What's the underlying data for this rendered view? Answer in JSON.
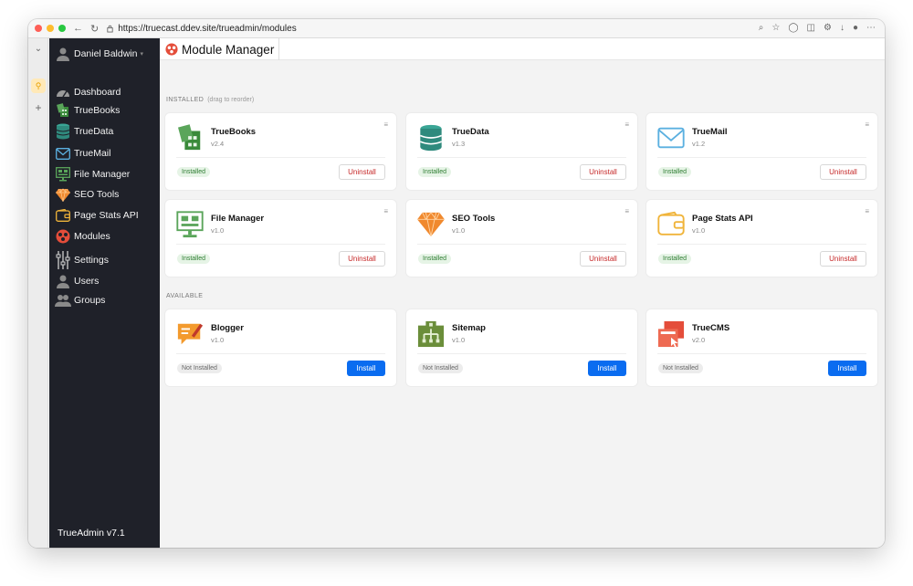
{
  "browser": {
    "url": "https://truecast.ddev.site/trueadmin/modules"
  },
  "sidebar": {
    "user": "Daniel Baldwin",
    "items": [
      {
        "label": "Dashboard",
        "icon": "dashboard-icon"
      },
      {
        "label": "TrueBooks",
        "icon": "truebooks-icon"
      },
      {
        "label": "TrueData",
        "icon": "database-icon"
      },
      {
        "label": "TrueMail",
        "icon": "mail-icon"
      },
      {
        "label": "File Manager",
        "icon": "file-manager-icon"
      },
      {
        "label": "SEO Tools",
        "icon": "gem-icon"
      },
      {
        "label": "Page Stats API",
        "icon": "wallet-icon"
      },
      {
        "label": "Modules",
        "icon": "modules-icon"
      },
      {
        "label": "Settings",
        "icon": "sliders-icon"
      },
      {
        "label": "Users",
        "icon": "user-icon"
      },
      {
        "label": "Groups",
        "icon": "group-icon"
      }
    ],
    "footer": "TrueAdmin v7.1"
  },
  "header": {
    "title": "Module Manager"
  },
  "sections": {
    "installed_label": "INSTALLED",
    "installed_hint": "(drag to reorder)",
    "available_label": "AVAILABLE"
  },
  "installed_modules": [
    {
      "name": "TrueBooks",
      "version": "v2.4",
      "status": "Installed",
      "action": "Uninstall"
    },
    {
      "name": "TrueData",
      "version": "v1.3",
      "status": "Installed",
      "action": "Uninstall"
    },
    {
      "name": "TrueMail",
      "version": "v1.2",
      "status": "Installed",
      "action": "Uninstall"
    },
    {
      "name": "File Manager",
      "version": "v1.0",
      "status": "Installed",
      "action": "Uninstall"
    },
    {
      "name": "SEO Tools",
      "version": "v1.0",
      "status": "Installed",
      "action": "Uninstall"
    },
    {
      "name": "Page Stats API",
      "version": "v1.0",
      "status": "Installed",
      "action": "Uninstall"
    }
  ],
  "available_modules": [
    {
      "name": "Blogger",
      "version": "v1.0",
      "status": "Not Installed",
      "action": "Install"
    },
    {
      "name": "Sitemap",
      "version": "v1.0",
      "status": "Not Installed",
      "action": "Install"
    },
    {
      "name": "TrueCMS",
      "version": "v2.0",
      "status": "Not Installed",
      "action": "Install"
    }
  ],
  "colors": {
    "sidebar_bg": "#1f2129",
    "install_button": "#0a6cf0",
    "uninstall_text": "#c62828",
    "installed_badge": "#2e7d32"
  }
}
